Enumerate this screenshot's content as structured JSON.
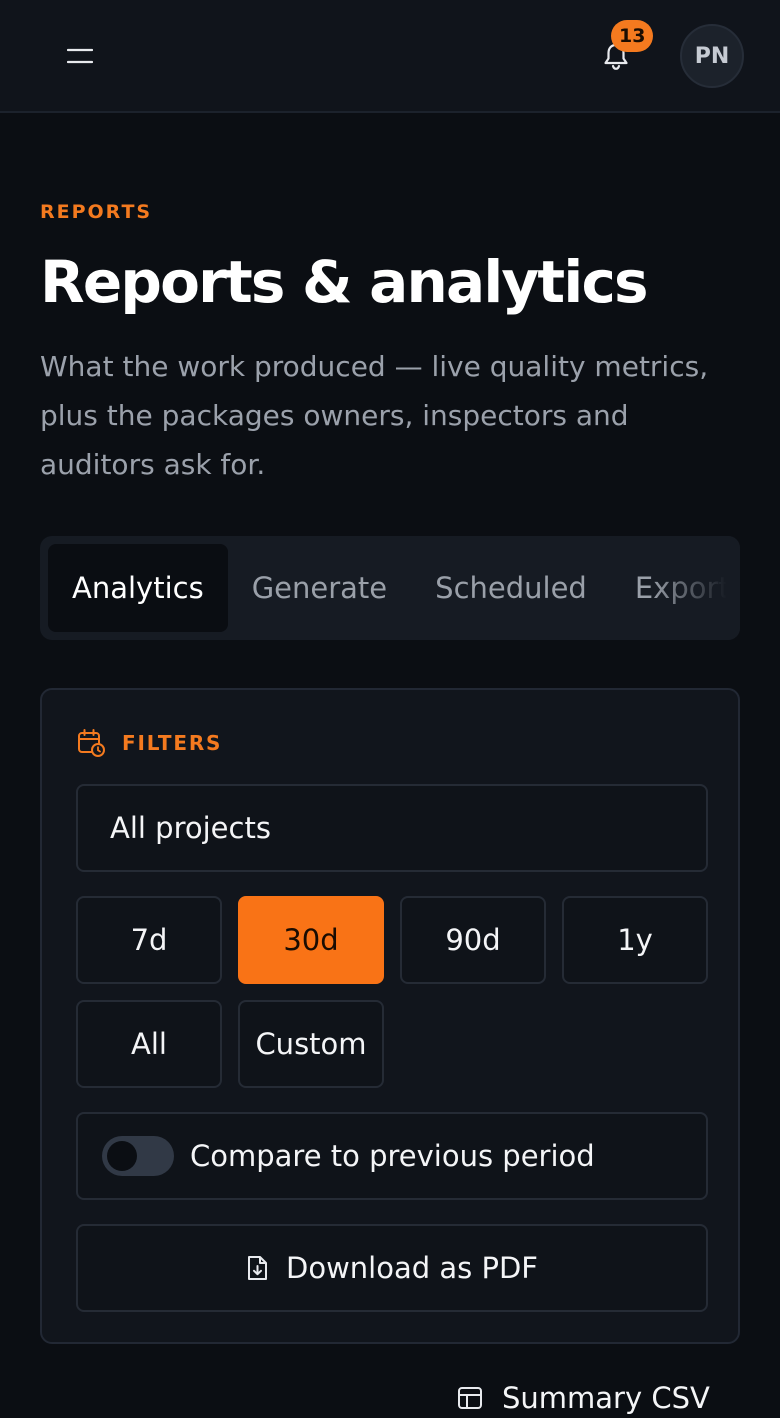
{
  "header": {
    "notification_count": "13",
    "avatar_initials": "PN"
  },
  "page": {
    "eyebrow": "REPORTS",
    "title": "Reports & analytics",
    "description": "What the work produced — live quality metrics, plus the packages owners, inspectors and auditors ask for."
  },
  "tabs": [
    {
      "label": "Analytics",
      "active": true
    },
    {
      "label": "Generate",
      "active": false
    },
    {
      "label": "Scheduled",
      "active": false
    },
    {
      "label": "Export l",
      "active": false
    }
  ],
  "filters": {
    "label": "FILTERS",
    "project_select": "All projects",
    "ranges": [
      {
        "label": "7d",
        "active": false
      },
      {
        "label": "30d",
        "active": true
      },
      {
        "label": "90d",
        "active": false
      },
      {
        "label": "1y",
        "active": false
      },
      {
        "label": "All",
        "active": false
      },
      {
        "label": "Custom",
        "active": false
      }
    ],
    "compare_label": "Compare to previous period",
    "compare_enabled": false,
    "download_pdf_label": "Download as PDF"
  },
  "actions": {
    "summary_csv_label": "Summary CSV"
  },
  "colors": {
    "accent": "#f97316",
    "background": "#0b0e13",
    "card": "#11151c"
  }
}
